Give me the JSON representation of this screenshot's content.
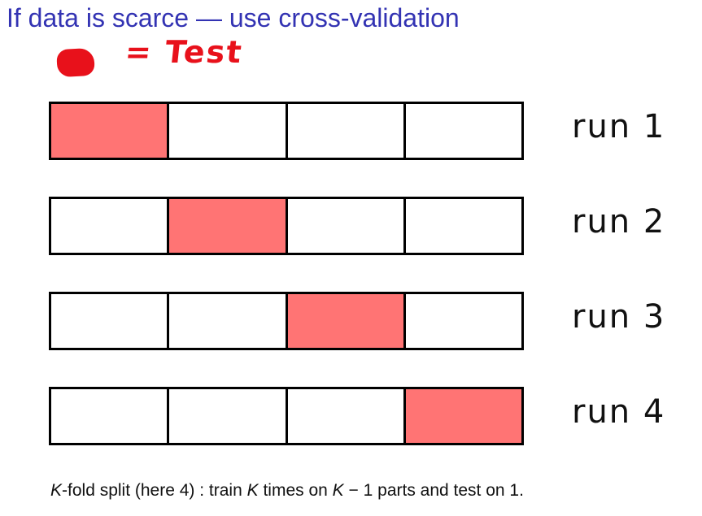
{
  "title": "If data is scarce — use cross-validation",
  "annotation": {
    "text": "= Test",
    "color": "#e8111b"
  },
  "colors": {
    "test": "#ff7474",
    "train": "#ffffff",
    "title": "#3333b3"
  },
  "runs": [
    {
      "label": "run 1",
      "test_fold": 1
    },
    {
      "label": "run 2",
      "test_fold": 2
    },
    {
      "label": "run 3",
      "test_fold": 3
    },
    {
      "label": "run 4",
      "test_fold": 4
    }
  ],
  "folds_per_run": 4,
  "caption": {
    "k": "K",
    "part1": "-fold split (here 4) : train ",
    "part2": " times on ",
    "part3": " − 1 parts and test on 1."
  }
}
